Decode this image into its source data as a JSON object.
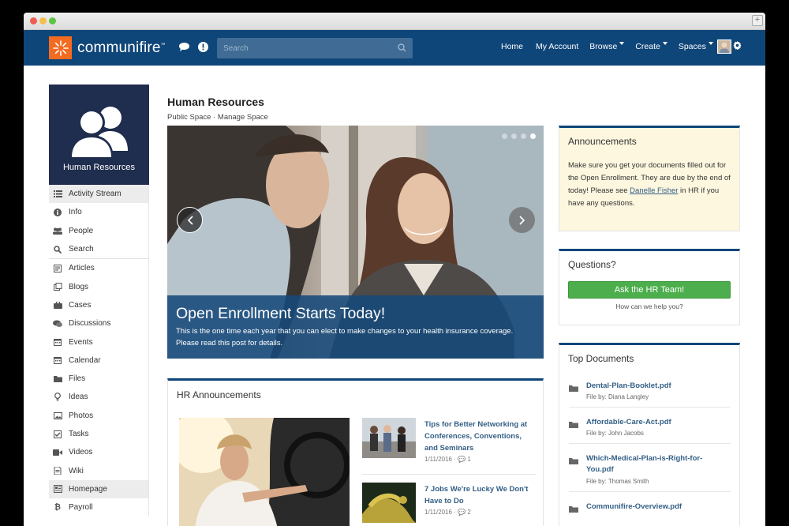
{
  "navbar": {
    "brand": "communifire",
    "brand_mark": "™",
    "search_placeholder": "Search",
    "links": [
      {
        "label": "Home",
        "dropdown": false
      },
      {
        "label": "My Account",
        "dropdown": false
      },
      {
        "label": "Browse",
        "dropdown": true
      },
      {
        "label": "Create",
        "dropdown": true
      },
      {
        "label": "Spaces",
        "dropdown": true
      }
    ]
  },
  "sidebar": {
    "space_name": "Human Resources",
    "items": [
      {
        "label": "Activity Stream",
        "icon": "list-icon"
      },
      {
        "label": "Info",
        "icon": "info-icon"
      },
      {
        "label": "People",
        "icon": "people-icon"
      },
      {
        "label": "Search",
        "icon": "search-icon"
      },
      {
        "label": "Articles",
        "icon": "article-icon"
      },
      {
        "label": "Blogs",
        "icon": "blog-icon"
      },
      {
        "label": "Cases",
        "icon": "briefcase-icon"
      },
      {
        "label": "Discussions",
        "icon": "chat-icon"
      },
      {
        "label": "Events",
        "icon": "calendar-icon"
      },
      {
        "label": "Calendar",
        "icon": "calendar-icon"
      },
      {
        "label": "Files",
        "icon": "folder-icon"
      },
      {
        "label": "Ideas",
        "icon": "lightbulb-icon"
      },
      {
        "label": "Photos",
        "icon": "photo-icon"
      },
      {
        "label": "Tasks",
        "icon": "checkbox-icon"
      },
      {
        "label": "Videos",
        "icon": "video-icon"
      },
      {
        "label": "Wiki",
        "icon": "wiki-icon"
      },
      {
        "label": "Homepage",
        "icon": "homepage-icon"
      },
      {
        "label": "Payroll",
        "icon": "bitcoin-icon"
      }
    ]
  },
  "main": {
    "title": "Human Resources",
    "subtitle_public": "Public Space",
    "subtitle_sep": " · ",
    "subtitle_manage": "Manage Space",
    "hero": {
      "title": "Open Enrollment Starts Today!",
      "text_line1": "This is the one time each year that you can elect to make changes to your health insurance coverage.",
      "text_line2": "Please read this post for details."
    },
    "announcements": {
      "heading": "HR Announcements",
      "posts": [
        {
          "title": "Tips for Better Networking at Conferences, Conventions, and Seminars",
          "date": "1/11/2016",
          "comments": "1"
        },
        {
          "title": "7 Jobs We're Lucky We Don't Have to Do",
          "date": "1/11/2016",
          "comments": "2"
        }
      ]
    }
  },
  "right": {
    "announcements": {
      "heading": "Announcements",
      "text_before": "Make sure you get your documents filled out for the Open Enrollment. They are due by the end of today! Please see ",
      "link": "Danelle Fisher",
      "text_after": " in HR if you have any questions."
    },
    "questions": {
      "heading": "Questions?",
      "button": "Ask the HR Team!",
      "sub": "How can we help you?"
    },
    "top_documents": {
      "heading": "Top Documents",
      "docs": [
        {
          "name": "Dental-Plan-Booklet.pdf",
          "by": "File by: Diana Langley"
        },
        {
          "name": "Affordable-Care-Act.pdf",
          "by": "File by: John Jacobs"
        },
        {
          "name": "Which-Medical-Plan-is-Right-for-You.pdf",
          "by": "File by: Thomas Smith"
        },
        {
          "name": "Communifire-Overview.pdf",
          "by": ""
        }
      ]
    }
  },
  "colors": {
    "navbar": "#0f4679",
    "brand_orange": "#f26b21",
    "space_tile": "#1f2d4e",
    "accent_green": "#4cae4c",
    "link": "#335f86",
    "announce_bg": "#fdf7df"
  }
}
